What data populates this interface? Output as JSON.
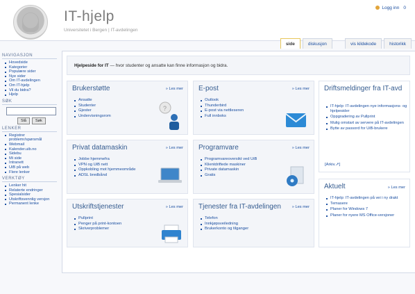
{
  "header": {
    "site_title": "IT-hjelp",
    "breadcrumb": "Universitetet i Bergen | IT-avdelingen",
    "login_label": "Logg inn",
    "login_extra": "0"
  },
  "tabs": [
    "side",
    "diskusjon",
    "vis kildekode",
    "historikk"
  ],
  "sidebar": {
    "navigation": {
      "title": "NAVIGASJON",
      "items": [
        "Hovedside",
        "Kategorier",
        "Populære sider",
        "Nye sider",
        "Om IT-avdelingen",
        "Om IT-hjelp",
        "Vil du bidra?",
        "Hjelp"
      ]
    },
    "search": {
      "title": "SØK",
      "go_label": "Slå",
      "search_label": "Søk"
    },
    "links": {
      "title": "LENKER",
      "items": [
        "Registrer problemr/spørsmål",
        "Webmail",
        "Kalender.uib.no",
        "Sidebu",
        "Mi side",
        "Intranett",
        "UiB på web",
        "Flere lenker"
      ]
    },
    "tools": {
      "title": "VERKTØY",
      "items": [
        "Lenker hit",
        "Relaterte endringer",
        "Spesialsider",
        "Utskriftsvennlig versjon",
        "Permanent lenke"
      ]
    }
  },
  "intro": {
    "bold": "Hjelpeside for IT",
    "rest": " — hvor studenter og ansatte kan finne informasjon og bidra."
  },
  "boxes": [
    {
      "title": "Brukerstøtte",
      "more": "» Les mer",
      "items": [
        "Ansatte",
        "Studenter",
        "Gjester",
        "Undervisningsrom"
      ]
    },
    {
      "title": "E-post",
      "more": "» Les mer",
      "items": [
        "Outlook",
        "Thunderbird",
        "E-post via nettleseren",
        "Full innboks"
      ]
    },
    {
      "title": "Privat datamaskin",
      "more": "» Les mer",
      "items": [
        "Jobbe hjemmefra",
        "VPN og UiB nett",
        "Oppkobling mot hjemmeområde",
        "ADSL bredbånd"
      ]
    },
    {
      "title": "Programvare",
      "more": "» Les mer",
      "items": [
        "Programvareoversikt ved UiB",
        "Klientdriftede maskiner",
        "Private datamaskin",
        "Gratis"
      ]
    },
    {
      "title": "Utskriftstjenester",
      "more": "» Les mer",
      "items": [
        "Pullprint",
        "Penger på print-kontoen",
        "Skriverproblemer"
      ]
    },
    {
      "title": "Tjenester fra IT-avdelingen",
      "more": "» Les mer",
      "items": [
        "Telefon",
        "Innkjøpsveiledning",
        "Brukerkonto og tilganger"
      ]
    }
  ],
  "ops": {
    "title": "Driftsmeldinger fra IT-avd",
    "items": [
      "IT-hjelp: IT-avdelingen nye informasjons- og hjelpesider",
      "Oppgradering av Pullprint",
      "Mulig omstart av servere på IT-avdelingen",
      "Bytte av passord for UiB-brukere"
    ],
    "archive": "[Arkiv.➚]"
  },
  "news": {
    "title": "Aktuelt",
    "more": "» Les mer",
    "items": [
      "IT-hjelp: IT-avdelingen på vei i ny drakt",
      "Temasere",
      "Planer for Windows 7",
      "Planer for nyere MS Office-versjoner"
    ]
  }
}
